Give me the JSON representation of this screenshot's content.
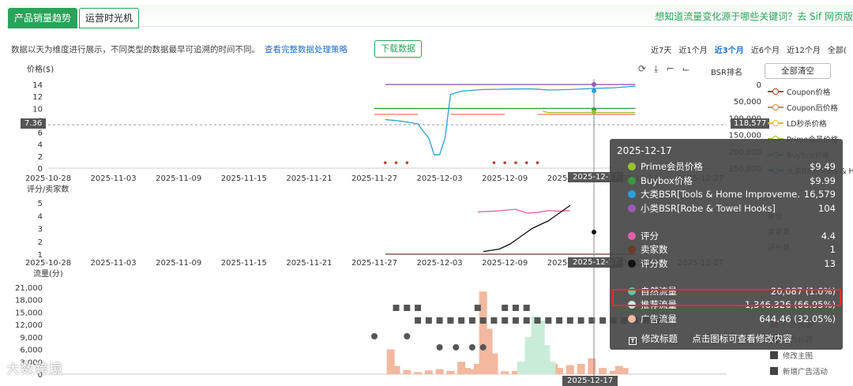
{
  "tabs": {
    "sales": "产品销量趋势",
    "ops": "运营时光机"
  },
  "ask": "想知道流量变化源于哪些关键词？去 Sif 网页版",
  "note": {
    "text": "数据以天为维度进行展示，不同类型的数据最早可追溯的时间不同。",
    "link": "查看完整数据处理策略"
  },
  "download": "下载数据",
  "ranges": [
    "近7天",
    "近1个月",
    "近3个月",
    "近6个月",
    "近12个月",
    "全部("
  ],
  "range_selected": 2,
  "tools_icons": [
    "refresh-icon",
    "download-icon",
    "crop-icon",
    "crop-reset-icon"
  ],
  "tools": "⟳⤓⌐⌙",
  "bsr_label": "BSR排名",
  "clear_all": "全部清空",
  "legend_top": [
    {
      "name": "Coupon价格",
      "color": "#c0392b"
    },
    {
      "name": "Coupon后价格",
      "color": "#e67e5a"
    },
    {
      "name": "LD秒杀价格",
      "color": "#e0c020"
    },
    {
      "name": "Prime会员价格",
      "color": "#9ac030"
    },
    {
      "name": "Buybox价格",
      "color": "#3a9a40"
    },
    {
      "name": "大类BSR[Tools & H",
      "color": "#2aa0d8"
    }
  ],
  "legend_mid": [
    {
      "name": "评分",
      "color": "#666"
    },
    {
      "name": "卖家数",
      "color": "#666"
    },
    {
      "name": "评分数",
      "color": "#666"
    }
  ],
  "legend_bot": [
    {
      "name": "广告流量",
      "icon": "square-icon"
    },
    {
      "name": "修改标题",
      "icon": "title-icon"
    },
    {
      "name": "修改主图",
      "icon": "image-icon"
    },
    {
      "name": "新增广告活动",
      "icon": "ad-icon"
    }
  ],
  "current": {
    "price": "7.36",
    "rank": "118,577"
  },
  "tooltip": {
    "date": "2025-12-17",
    "rows": [
      {
        "name": "Prime会员价格",
        "value": "$9.49",
        "color": "#9ac030"
      },
      {
        "name": "Buybox价格",
        "value": "$9.99",
        "color": "#3a9a40"
      },
      {
        "name": "大类BSR[Tools & Home Improveme...",
        "value": "16,579",
        "color": "#2aa0d8"
      },
      {
        "name": "小类BSR[Robe & Towel Hooks]",
        "value": "104",
        "color": "#9b59b6"
      }
    ],
    "rows2": [
      {
        "name": "评分",
        "value": "4.4",
        "color": "#e060a8"
      },
      {
        "name": "卖家数",
        "value": "1",
        "color": "#6b3a2a"
      },
      {
        "name": "评分数",
        "value": "13",
        "color": "#111"
      }
    ],
    "rows3": [
      {
        "name": "自然流量",
        "value": "20,087 (1.0%)",
        "color": "#60c898"
      },
      {
        "name": "推荐流量",
        "value": "1,346.326 (66.95%)",
        "color": "#c8ecd8"
      },
      {
        "name": "广告流量",
        "value": "644.46 (32.05%)",
        "color": "#f2b8a0"
      }
    ],
    "foot": {
      "icon": "T",
      "label": "修改标题",
      "hint": "点击图标可查看修改内容"
    }
  },
  "watermark": "大数跨境",
  "chart_data": [
    {
      "type": "line",
      "ylabel": "价格($)",
      "ylim": [
        0,
        14
      ],
      "yticks": [
        0,
        2,
        4,
        6,
        8,
        10,
        12,
        14
      ],
      "y2label": "BSR排名",
      "y2lim": [
        0,
        250000
      ],
      "y2ticks": [
        "0",
        "50,000",
        "100,000",
        "150,000",
        "200,000",
        "250,000"
      ],
      "x_ticks": [
        "2025-10-28",
        "2025-11-03",
        "2025-11-09",
        "2025-11-15",
        "2025-11-21",
        "2025-11-27",
        "2025-12-03",
        "2025-12-09",
        "2025-12-15",
        "2025-12-21",
        "2025-12-27"
      ],
      "series": [
        {
          "name": "Coupon价格",
          "color": "#c0392b",
          "points": [
            [
              31,
              0.9
            ],
            [
              32,
              0.9
            ],
            [
              33,
              0.9
            ],
            [
              41,
              0.9
            ],
            [
              42,
              0.9
            ],
            [
              43,
              0.9
            ],
            [
              44,
              0.9
            ],
            [
              45,
              0.9
            ]
          ]
        },
        {
          "name": "Coupon后价格",
          "color": "#e67e5a",
          "segments": [
            [
              [
                30,
                9.0
              ],
              [
                34,
                9.0
              ]
            ],
            [
              [
                37,
                9.0
              ],
              [
                42,
                9.0
              ]
            ],
            [
              [
                45,
                9.0
              ],
              [
                54,
                9.0
              ]
            ]
          ]
        },
        {
          "name": "Prime会员价格",
          "color": "#9ac030",
          "points": [
            [
              45.5,
              9.49
            ],
            [
              46,
              9.3
            ],
            [
              54,
              9.3
            ]
          ]
        },
        {
          "name": "Buybox价格",
          "color": "#3a9a40",
          "points": [
            [
              30,
              9.99
            ],
            [
              54,
              9.99
            ]
          ]
        },
        {
          "name": "大类BSR[Tools & H",
          "color": "#2aa0d8",
          "y_axis": "right",
          "points": [
            [
              31,
              105000
            ],
            [
              32,
              108000
            ],
            [
              33,
              112000
            ],
            [
              34,
              118000
            ],
            [
              34.5,
              140000
            ],
            [
              35,
              160000
            ],
            [
              35.5,
              210000
            ],
            [
              36,
              210000
            ],
            [
              36.5,
              160000
            ],
            [
              37,
              30000
            ],
            [
              38,
              20000
            ],
            [
              40,
              15000
            ],
            [
              42,
              14000
            ],
            [
              44,
              13000
            ],
            [
              45,
              14000
            ],
            [
              46,
              16579
            ],
            [
              48,
              15000
            ],
            [
              50,
              12000
            ],
            [
              52,
              10000
            ],
            [
              54,
              5000
            ]
          ]
        },
        {
          "name": "小类BSR[Robe & Towel Hooks]",
          "color": "#9b59b6",
          "y_axis": "right",
          "points": [
            [
              31,
              104
            ],
            [
              54,
              104
            ]
          ]
        }
      ]
    },
    {
      "type": "line",
      "ylabel": "评分/卖家数",
      "ylim": [
        1,
        5
      ],
      "yticks": [
        1,
        2,
        3,
        4,
        5
      ],
      "y2lim": [
        0,
        20
      ],
      "series": [
        {
          "name": "评分",
          "color": "#e060a8",
          "points": [
            [
              39.5,
              4.3
            ],
            [
              41,
              4.35
            ],
            [
              43,
              4.5
            ],
            [
              44,
              4.2
            ],
            [
              45,
              4.25
            ],
            [
              46,
              4.4
            ],
            [
              47,
              4.35
            ],
            [
              48,
              4.4
            ]
          ]
        },
        {
          "name": "卖家数",
          "color": "#6b3a2a",
          "points": [
            [
              31,
              1
            ],
            [
              54,
              1
            ]
          ]
        },
        {
          "name": "评分数",
          "color": "#111",
          "y_axis": "right",
          "points": [
            [
              40,
              1
            ],
            [
              41.5,
              2
            ],
            [
              42.5,
              4
            ],
            [
              43.5,
              7
            ],
            [
              44.5,
              10
            ],
            [
              46,
              13
            ],
            [
              47,
              16
            ],
            [
              48,
              19
            ]
          ]
        }
      ]
    },
    {
      "type": "bar",
      "ylabel": "流量(分)",
      "ylim": [
        0,
        21000
      ],
      "yticks": [
        "0",
        "3,000",
        "6,000",
        "9,000",
        "12,000",
        "15,000",
        "18,000",
        "21,000"
      ],
      "series": [
        {
          "name": "广告流量",
          "color": "#f2b8a0",
          "values": [
            [
              31.5,
              6000
            ],
            [
              32,
              2000
            ],
            [
              33,
              1000
            ],
            [
              34,
              500
            ],
            [
              35,
              900
            ],
            [
              36,
              1200
            ],
            [
              37,
              800
            ],
            [
              38,
              3000
            ],
            [
              38.5,
              1500
            ],
            [
              39,
              1200
            ],
            [
              39.5,
              2500
            ],
            [
              40,
              20000
            ],
            [
              40.5,
              11000
            ],
            [
              41,
              5000
            ],
            [
              42,
              700
            ],
            [
              43,
              800
            ],
            [
              44,
              1000
            ],
            [
              44.5,
              2000
            ],
            [
              46.5,
              2500
            ],
            [
              47,
              1500
            ],
            [
              48,
              2200
            ],
            [
              49,
              2500
            ],
            [
              50,
              3800
            ],
            [
              51,
              1500
            ],
            [
              52,
              800
            ],
            [
              52.5,
              2000
            ],
            [
              53,
              1500
            ]
          ]
        },
        {
          "name": "推荐流量",
          "color": "#c8ecd8",
          "values": [
            [
              43.5,
              3000
            ],
            [
              44.2,
              9000
            ],
            [
              44.8,
              14000
            ],
            [
              45.3,
              13000
            ],
            [
              45.8,
              7000
            ],
            [
              46.3,
              3000
            ]
          ]
        }
      ]
    }
  ]
}
